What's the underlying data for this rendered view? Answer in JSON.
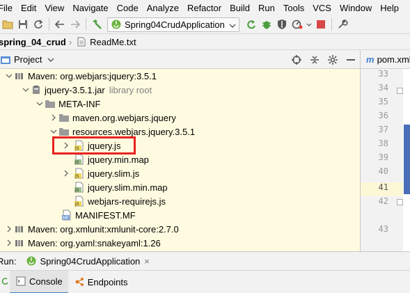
{
  "menu": [
    "File",
    "Edit",
    "View",
    "Navigate",
    "Code",
    "Analyze",
    "Refactor",
    "Build",
    "Run",
    "Tools",
    "VCS",
    "Window",
    "Help"
  ],
  "toolbar": {
    "run_config": "Spring04CrudApplication"
  },
  "breadcrumb": {
    "project": "spring_04_crud",
    "file": "ReadMe.txt"
  },
  "project_panel": {
    "title": "Project"
  },
  "tree": [
    {
      "label": "Maven: org.webjars:jquery:3.5.1",
      "extra": "",
      "icon": "library-icon"
    },
    {
      "label": "jquery-3.5.1.jar",
      "extra": "library root",
      "icon": "jar-icon"
    },
    {
      "label": "META-INF",
      "extra": "",
      "icon": "folder-icon"
    },
    {
      "label": "maven.org.webjars.jquery",
      "extra": "",
      "icon": "folder-icon"
    },
    {
      "label": "resources.webjars.jquery.3.5.1",
      "extra": "",
      "icon": "folder-icon"
    },
    {
      "label": "jquery.js",
      "extra": "",
      "icon": "js-file-icon"
    },
    {
      "label": "jquery.min.map",
      "extra": "",
      "icon": "map-file-icon"
    },
    {
      "label": "jquery.slim.js",
      "extra": "",
      "icon": "js-file-icon"
    },
    {
      "label": "jquery.slim.min.map",
      "extra": "",
      "icon": "map-file-icon"
    },
    {
      "label": "webjars-requirejs.js",
      "extra": "",
      "icon": "js-file-icon"
    },
    {
      "label": "MANIFEST.MF",
      "extra": "",
      "icon": "manifest-file-icon"
    },
    {
      "label": "Maven: org.xmlunit:xmlunit-core:2.7.0",
      "extra": "",
      "icon": "library-icon"
    },
    {
      "label": "Maven: org.yaml:snakeyaml:1.26",
      "extra": "",
      "icon": "library-icon"
    }
  ],
  "editor": {
    "tab": "pom.xml",
    "line_numbers": [
      "33",
      "34",
      "35",
      "36",
      "37",
      "38",
      "39",
      "40",
      "41",
      "42",
      "43"
    ],
    "current_line": "41"
  },
  "run_panel": {
    "label": "Run:",
    "config": "Spring04CrudApplication",
    "tabs": [
      "Console",
      "Endpoints"
    ]
  },
  "colors": {
    "highlight_box": "#e8231f",
    "tree_background": "#fffbe0"
  }
}
